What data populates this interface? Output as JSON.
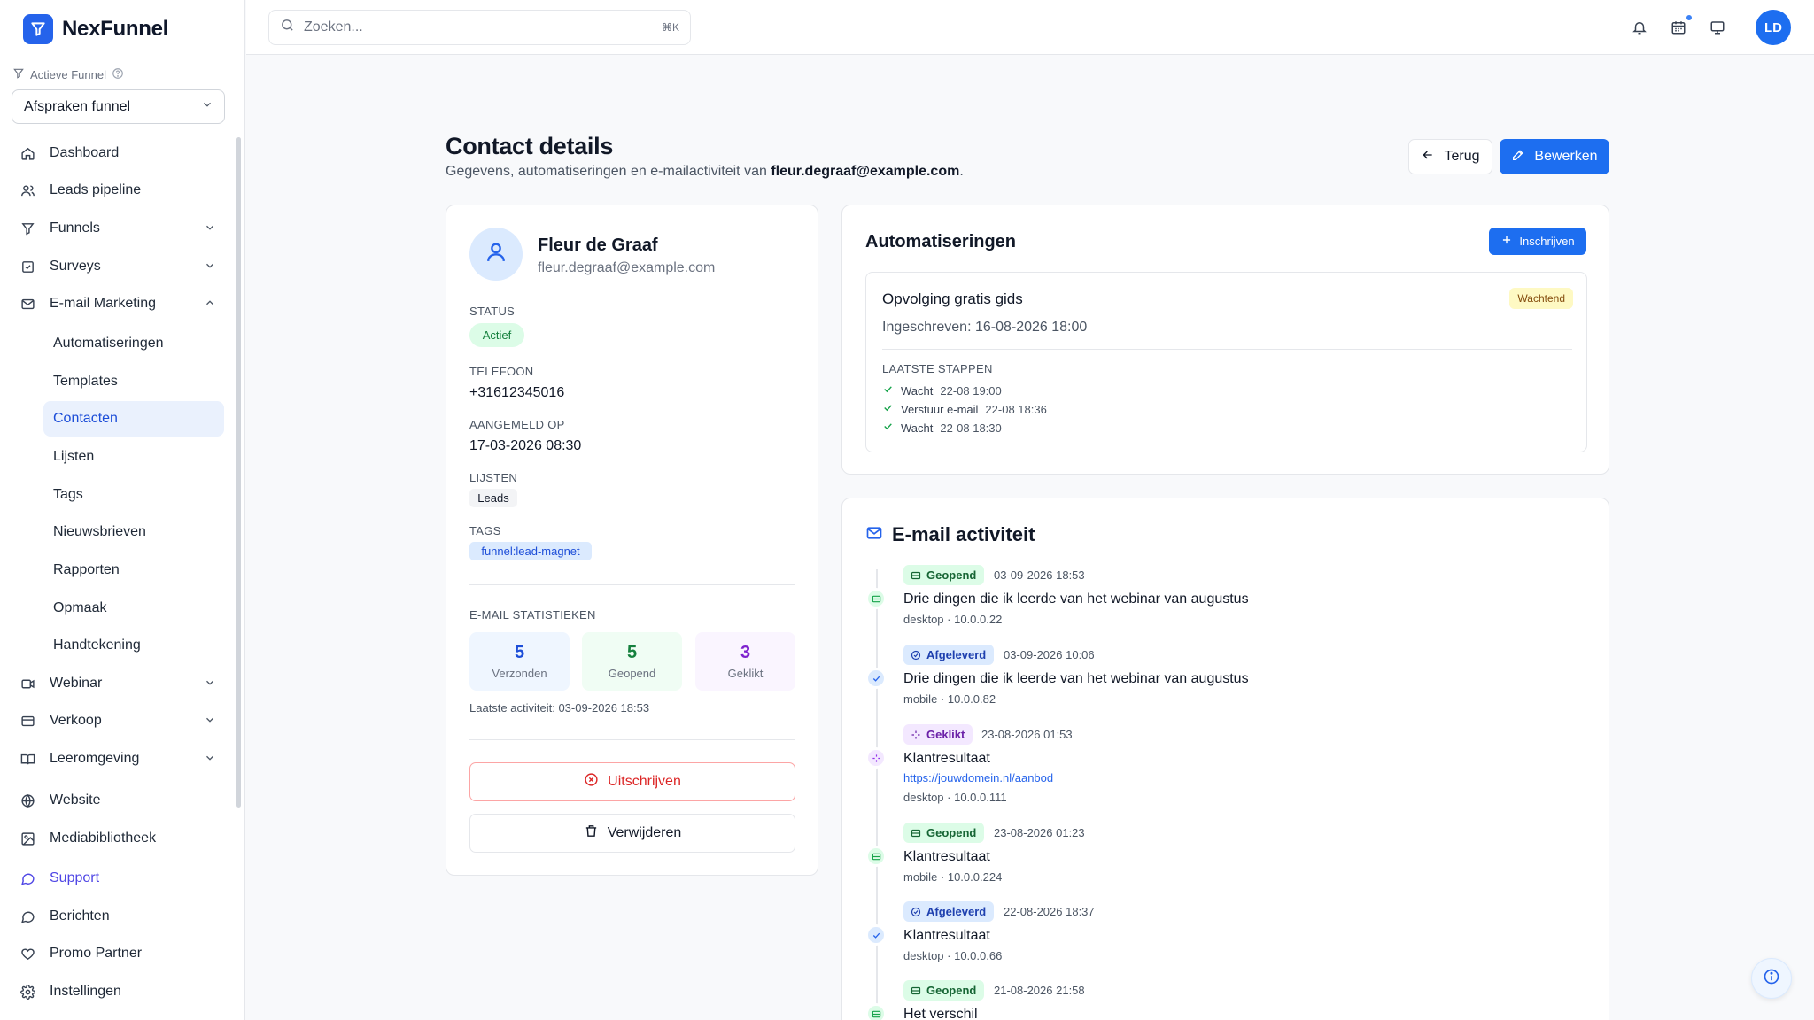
{
  "brand": {
    "name": "NexFunnel"
  },
  "active_funnel": {
    "label": "Actieve Funnel",
    "selected": "Afspraken funnel"
  },
  "sidebar": {
    "items": [
      {
        "label": "Dashboard",
        "icon": "home-icon"
      },
      {
        "label": "Leads pipeline",
        "icon": "users-icon"
      },
      {
        "label": "Funnels",
        "icon": "funnel-icon",
        "expandable": true
      },
      {
        "label": "Surveys",
        "icon": "checkbox-icon",
        "expandable": true
      },
      {
        "label": "E-mail Marketing",
        "icon": "mail-icon",
        "expanded": true
      }
    ],
    "email_sub": [
      "Automatiseringen",
      "Templates",
      "Contacten",
      "Lijsten",
      "Tags",
      "Nieuwsbrieven",
      "Rapporten",
      "Opmaak",
      "Handtekening"
    ],
    "active_sub": "Contacten",
    "items_after": [
      {
        "label": "Webinar",
        "icon": "video-icon"
      },
      {
        "label": "Verkoop",
        "icon": "card-icon"
      },
      {
        "label": "Leeromgeving",
        "icon": "book-icon"
      },
      {
        "label": "Website",
        "icon": "globe-icon"
      },
      {
        "label": "Mediabibliotheek",
        "icon": "image-icon"
      },
      {
        "label": "Support",
        "icon": "chat-icon"
      },
      {
        "label": "Berichten",
        "icon": "message-icon"
      },
      {
        "label": "Promo Partner",
        "icon": "heart-icon"
      },
      {
        "label": "Instellingen",
        "icon": "gear-icon"
      }
    ]
  },
  "topbar": {
    "search_placeholder": "Zoeken...",
    "shortcut": "⌘K",
    "avatar_initials": "LD"
  },
  "page": {
    "title": "Contact details",
    "subtitle_prefix": "Gegevens, automatiseringen en e-mailactiviteit van",
    "subtitle_email": "fleur.degraaf@example.com",
    "subtitle_suffix": ".",
    "back_label": "Terug",
    "edit_label": "Bewerken"
  },
  "contact": {
    "name": "Fleur de Graaf",
    "email": "fleur.degraaf@example.com",
    "status_label": "STATUS",
    "status": "Actief",
    "phone_label": "TELEFOON",
    "phone": "+31612345016",
    "signup_label": "AANGEMELD OP",
    "signup": "17-03-2026 08:30",
    "lists_label": "LIJSTEN",
    "list": "Leads",
    "tags_label": "TAGS",
    "tag": "funnel:lead-magnet",
    "stats_label": "E-MAIL STATISTIEKEN",
    "stats": [
      {
        "value": "5",
        "label": "Verzonden"
      },
      {
        "value": "5",
        "label": "Geopend"
      },
      {
        "value": "3",
        "label": "Geklikt"
      }
    ],
    "last_activity": "Laatste activiteit: 03-09-2026 18:53",
    "unsubscribe_label": "Uitschrijven",
    "delete_label": "Verwijderen"
  },
  "automations": {
    "title": "Automatiseringen",
    "enroll_label": "Inschrijven",
    "item": {
      "title": "Opvolging gratis gids",
      "status": "Wachtend",
      "enrolled": "Ingeschreven: 16-08-2026 18:00",
      "steps_label": "LAATSTE STAPPEN",
      "steps": [
        {
          "name": "Wacht",
          "time": "22-08 19:00"
        },
        {
          "name": "Verstuur e-mail",
          "time": "22-08 18:36"
        },
        {
          "name": "Wacht",
          "time": "22-08 18:30"
        }
      ]
    }
  },
  "email_activity": {
    "title": "E-mail activiteit",
    "events": [
      {
        "type": "Geopend",
        "color": "green",
        "date": "03-09-2026 18:53",
        "subject": "Drie dingen die ik leerde van het webinar van augustus",
        "meta": "desktop · 10.0.0.22"
      },
      {
        "type": "Afgeleverd",
        "color": "blue",
        "date": "03-09-2026 10:06",
        "subject": "Drie dingen die ik leerde van het webinar van augustus",
        "meta": "mobile · 10.0.0.82"
      },
      {
        "type": "Geklikt",
        "color": "purple",
        "date": "23-08-2026 01:53",
        "subject": "Klantresultaat",
        "link": "https://jouwdomein.nl/aanbod",
        "meta": "desktop · 10.0.0.111"
      },
      {
        "type": "Geopend",
        "color": "green",
        "date": "23-08-2026 01:23",
        "subject": "Klantresultaat",
        "meta": "mobile · 10.0.0.224"
      },
      {
        "type": "Afgeleverd",
        "color": "blue",
        "date": "22-08-2026 18:37",
        "subject": "Klantresultaat",
        "meta": "desktop · 10.0.0.66"
      },
      {
        "type": "Geopend",
        "color": "green",
        "date": "21-08-2026 21:58",
        "subject": "Het verschil",
        "meta": ""
      }
    ]
  },
  "colors": {
    "primary": "#1d6ef0",
    "danger": "#dc2626",
    "success": "#15803d",
    "purple": "#7e22ce"
  }
}
